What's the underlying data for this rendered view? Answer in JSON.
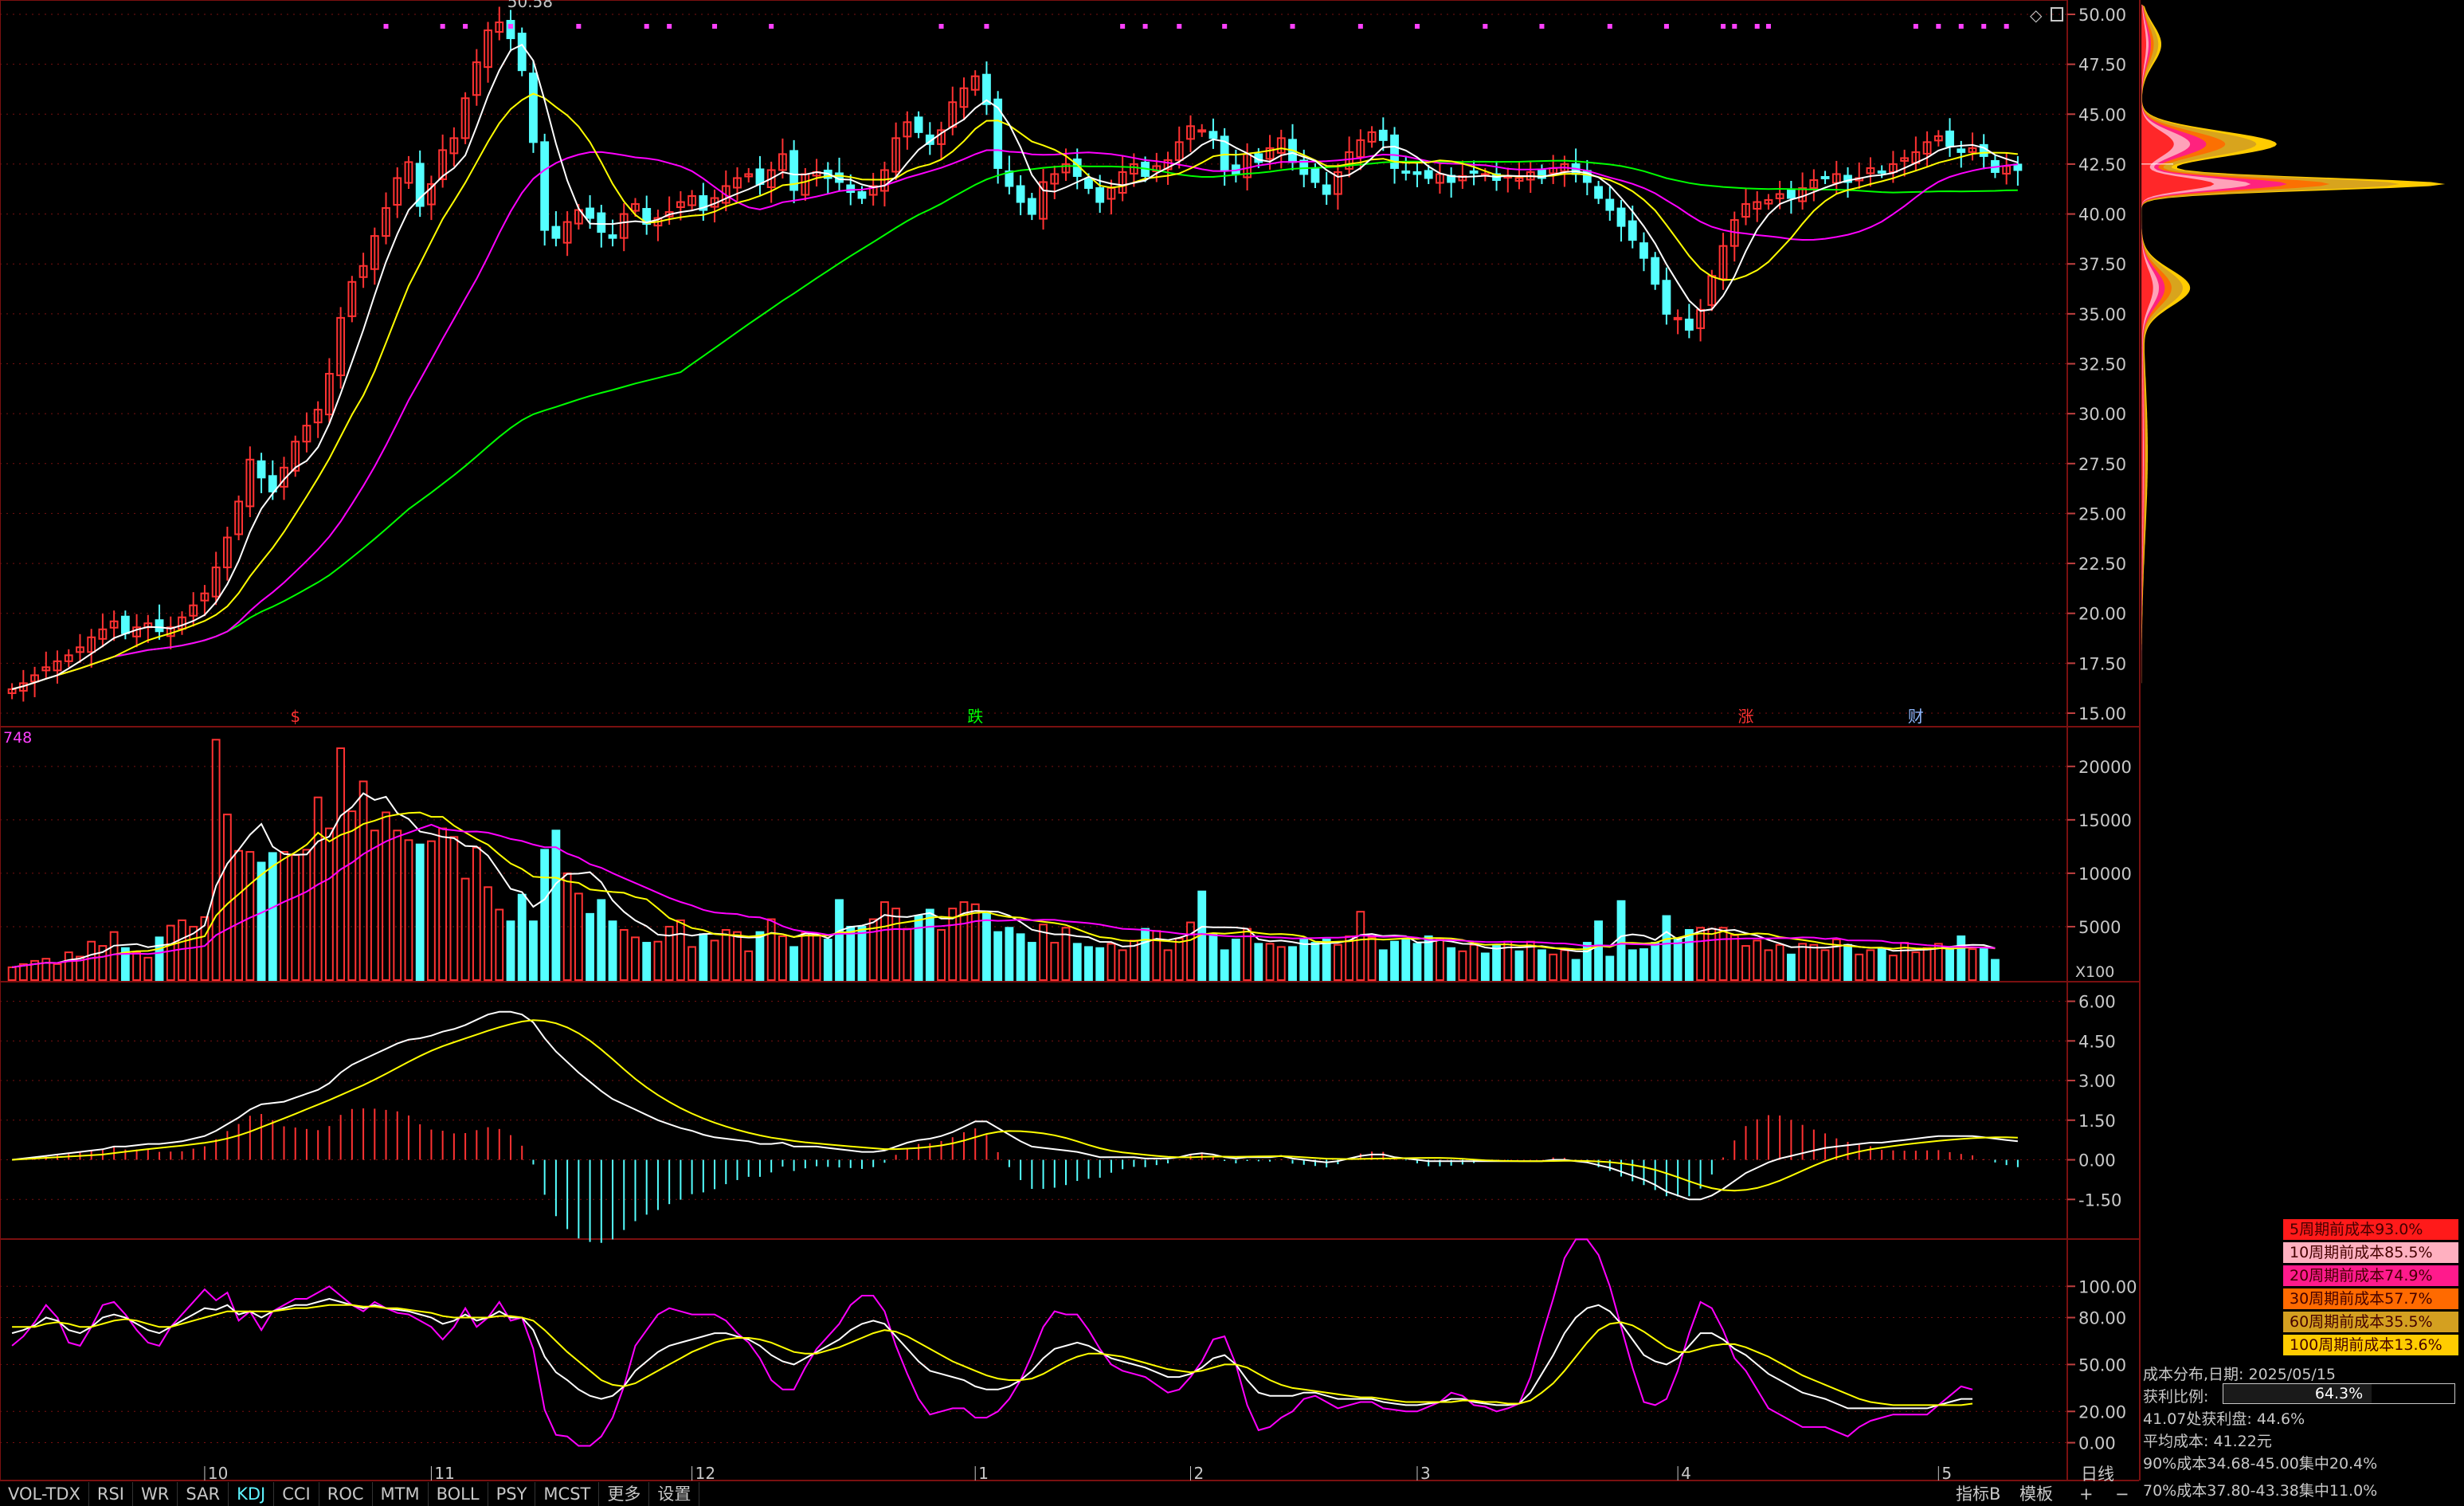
{
  "toolbar": {
    "tabs": [
      "VOL-TDX",
      "RSI",
      "WR",
      "SAR",
      "KDJ",
      "CCI",
      "ROC",
      "MTM",
      "BOLL",
      "PSY",
      "MCST",
      "更多",
      "设置"
    ],
    "active_tab": "KDJ",
    "right_buttons": [
      "指标B",
      "模板",
      "+",
      "−"
    ],
    "period": "日线"
  },
  "main_panel": {
    "price_ticks": [
      "50.00",
      "47.50",
      "45.00",
      "42.50",
      "40.00",
      "37.50",
      "35.00",
      "32.50",
      "30.00",
      "27.50",
      "25.00",
      "22.50",
      "20.00",
      "17.50",
      "15.00"
    ],
    "price_range": [
      15,
      50
    ],
    "high_label": "50.58",
    "markers": [
      {
        "text": "$",
        "idx": 25,
        "color": "#ff3232"
      },
      {
        "text": "跌",
        "idx": 85,
        "color": "#00ff00"
      },
      {
        "text": "涨",
        "idx": 153,
        "color": "#ff3232"
      },
      {
        "text": "财",
        "idx": 168,
        "color": "#8fb8ff"
      }
    ],
    "magenta_dot_indices": [
      33,
      38,
      40,
      44,
      50,
      56,
      58,
      62,
      67,
      82,
      86,
      98,
      100,
      103,
      107,
      113,
      119,
      124,
      130,
      135,
      141,
      146,
      151,
      152,
      154,
      155,
      168,
      170,
      172,
      174,
      176
    ]
  },
  "volume_panel": {
    "label": "748",
    "ticks": [
      "20000",
      "15000",
      "10000",
      "5000"
    ],
    "range": [
      0,
      22000
    ],
    "unit": "X100"
  },
  "macd_panel": {
    "ticks": [
      "6.00",
      "4.50",
      "3.00",
      "1.50",
      "0.00",
      "-1.50"
    ],
    "range": [
      -3.0,
      6.5
    ]
  },
  "kdj_panel": {
    "ticks": [
      "100.00",
      "80.00",
      "50.00",
      "20.00",
      "0.00"
    ],
    "range": [
      -15,
      120
    ]
  },
  "x_axis": {
    "months": [
      {
        "text": "10",
        "idx": 17
      },
      {
        "text": "11",
        "idx": 37
      },
      {
        "text": "12",
        "idx": 60
      },
      {
        "text": "1",
        "idx": 85
      },
      {
        "text": "2",
        "idx": 104
      },
      {
        "text": "3",
        "idx": 124
      },
      {
        "text": "4",
        "idx": 147
      },
      {
        "text": "5",
        "idx": 170
      }
    ]
  },
  "cost_distribution": {
    "legend": [
      {
        "label": "5周期前成本93.0%",
        "color": "#ff1a1a"
      },
      {
        "label": "10周期前成本85.5%",
        "color": "#ffb0c0"
      },
      {
        "label": "20周期前成本74.9%",
        "color": "#ff1a8c"
      },
      {
        "label": "30周期前成本57.7%",
        "color": "#ff6a00"
      },
      {
        "label": "60周期前成本35.5%",
        "color": "#d4a020"
      },
      {
        "label": "100周期前成本13.6%",
        "color": "#ffcc00"
      }
    ],
    "date_line": "成本分布,日期: 2025/05/15",
    "profit_ratio_label": "获利比例:",
    "profit_ratio": "64.3%",
    "profit_ratio_value": 0.643,
    "line_profit_at": "41.07处获利盘: 44.6%",
    "avg_cost": "平均成本: 41.22元",
    "cost_90": "90%成本34.68-45.00集中20.4%",
    "cost_70": "70%成本37.80-43.38集中11.0%"
  },
  "colors": {
    "up": "#ff3232",
    "down": "#54ffff",
    "ma5": "#ffffff",
    "ma10": "#ffff00",
    "ma20": "#ff00ff",
    "ma60": "#00ff00",
    "grid": "#7a1010"
  },
  "series": {
    "close": [
      16.2,
      16.5,
      16.9,
      17.3,
      17.6,
      17.9,
      18.3,
      18.8,
      19.2,
      19.6,
      19.0,
      19.3,
      19.5,
      19.1,
      19.3,
      19.8,
      20.4,
      21.0,
      22.3,
      23.8,
      25.6,
      27.7,
      26.8,
      26.1,
      27.3,
      28.6,
      29.4,
      30.2,
      32.0,
      34.8,
      36.6,
      37.4,
      38.9,
      40.3,
      41.8,
      42.6,
      40.4,
      41.5,
      43.2,
      43.8,
      45.8,
      47.6,
      49.2,
      49.6,
      48.8,
      47.2,
      43.6,
      39.2,
      38.8,
      39.6,
      40.2,
      39.8,
      39.1,
      38.8,
      40.0,
      40.5,
      39.5,
      39.8,
      40.1,
      40.6,
      40.9,
      40.2,
      40.8,
      41.4,
      41.8,
      42.0,
      41.5,
      42.2,
      43.0,
      41.2,
      42.0,
      42.1,
      41.8,
      41.6,
      41.1,
      40.8,
      41.4,
      42.2,
      43.8,
      44.6,
      44.1,
      43.5,
      44.2,
      45.6,
      46.3,
      46.9,
      45.5,
      42.3,
      41.4,
      40.6,
      40.0,
      41.6,
      42.0,
      42.5,
      41.9,
      41.3,
      40.6,
      41.3,
      42.1,
      42.5,
      41.9,
      42.4,
      42.7,
      43.6,
      44.4,
      44.2,
      43.8,
      42.2,
      42.0,
      43.0,
      42.6,
      43.3,
      43.8,
      42.6,
      42.0,
      41.6,
      41.0,
      42.1,
      43.1,
      43.7,
      44.1,
      43.7,
      42.3,
      42.1,
      42.0,
      41.8,
      42.0,
      41.6,
      41.9,
      42.1,
      42.0,
      41.7,
      41.9,
      41.8,
      42.1,
      41.8,
      42.3,
      42.5,
      42.0,
      41.6,
      40.8,
      40.2,
      39.4,
      38.7,
      37.8,
      36.5,
      35.0,
      34.8,
      34.2,
      35.2,
      36.9,
      38.4,
      39.7,
      40.5,
      40.6,
      40.7,
      41.0,
      40.8,
      41.3,
      41.7,
      41.8,
      42.0,
      41.6,
      41.8,
      42.3,
      42.1,
      42.5,
      42.8,
      43.1,
      43.6,
      43.9,
      43.4,
      43.1,
      43.3,
      42.9,
      42.1,
      42.4,
      42.2
    ],
    "volume": [
      1200,
      1500,
      1800,
      2000,
      1500,
      2600,
      2200,
      3600,
      3200,
      4500,
      3000,
      2600,
      2100,
      4000,
      5100,
      5600,
      5000,
      5900,
      22500,
      15500,
      12100,
      12000,
      11000,
      11900,
      12000,
      11700,
      12200,
      17100,
      14200,
      21700,
      15800,
      18600,
      14000,
      15700,
      14000,
      13100,
      12700,
      13000,
      14200,
      13400,
      9500,
      12400,
      8700,
      6600,
      5500,
      8000,
      5500,
      12200,
      14000,
      10000,
      8100,
      6200,
      7500,
      5500,
      4700,
      4000,
      3500,
      3600,
      5000,
      5600,
      3100,
      4300,
      3700,
      4700,
      4500,
      2700,
      4500,
      5700,
      4100,
      3100,
      4400,
      4200,
      3800,
      7500,
      5000,
      5000,
      5700,
      7300,
      6700,
      4800,
      6000,
      6600,
      4700,
      6700,
      7300,
      7100,
      6400,
      4500,
      4900,
      4300,
      3500,
      5200,
      3500,
      4900,
      3400,
      3100,
      3000,
      3400,
      2800,
      3700,
      4800,
      4600,
      2800,
      3900,
      5400,
      8300,
      4300,
      2800,
      3800,
      4800,
      3400,
      3400,
      3100,
      3100,
      3800,
      3500,
      3800,
      3300,
      4100,
      6400,
      4000,
      2800,
      3600,
      3800,
      3400,
      4100,
      3800,
      3000,
      2700,
      3300,
      2500,
      3200,
      3600,
      2700,
      3600,
      2800,
      2400,
      2800,
      1900,
      3500,
      5500,
      2200,
      7400,
      2800,
      2900,
      3500,
      6000,
      3800,
      4700,
      4900,
      4800,
      4900,
      4200,
      3200,
      3700,
      2800,
      3300,
      2400,
      3400,
      3300,
      2800,
      3800,
      3300,
      2400,
      2800,
      2900,
      2300,
      3500,
      2600,
      3000,
      3400,
      3100,
      4100,
      2900,
      2900,
      1900
    ],
    "dif": [
      0.0,
      0.05,
      0.1,
      0.15,
      0.2,
      0.25,
      0.3,
      0.35,
      0.4,
      0.5,
      0.5,
      0.55,
      0.6,
      0.6,
      0.65,
      0.7,
      0.8,
      0.9,
      1.1,
      1.35,
      1.6,
      1.9,
      2.1,
      2.15,
      2.2,
      2.35,
      2.5,
      2.65,
      2.9,
      3.3,
      3.6,
      3.8,
      4.0,
      4.2,
      4.4,
      4.55,
      4.6,
      4.7,
      4.85,
      4.95,
      5.1,
      5.3,
      5.5,
      5.6,
      5.6,
      5.5,
      5.2,
      4.6,
      4.1,
      3.7,
      3.3,
      2.95,
      2.6,
      2.3,
      2.1,
      1.9,
      1.7,
      1.5,
      1.35,
      1.2,
      1.1,
      0.95,
      0.85,
      0.8,
      0.75,
      0.7,
      0.6,
      0.6,
      0.65,
      0.5,
      0.5,
      0.5,
      0.45,
      0.4,
      0.35,
      0.3,
      0.3,
      0.35,
      0.5,
      0.65,
      0.75,
      0.8,
      0.9,
      1.05,
      1.25,
      1.45,
      1.45,
      1.2,
      0.95,
      0.7,
      0.5,
      0.45,
      0.4,
      0.35,
      0.3,
      0.2,
      0.1,
      0.1,
      0.1,
      0.1,
      0.05,
      0.05,
      0.05,
      0.1,
      0.2,
      0.25,
      0.2,
      0.1,
      0.05,
      0.1,
      0.1,
      0.1,
      0.15,
      0.05,
      0.0,
      -0.05,
      -0.1,
      -0.05,
      0.05,
      0.15,
      0.2,
      0.2,
      0.1,
      0.05,
      0.0,
      -0.05,
      -0.05,
      -0.05,
      -0.05,
      -0.05,
      -0.05,
      -0.05,
      -0.05,
      -0.05,
      -0.05,
      -0.05,
      0.0,
      0.0,
      -0.05,
      -0.1,
      -0.2,
      -0.3,
      -0.45,
      -0.6,
      -0.75,
      -0.95,
      -1.2,
      -1.35,
      -1.5,
      -1.5,
      -1.35,
      -1.1,
      -0.8,
      -0.5,
      -0.3,
      -0.1,
      0.05,
      0.15,
      0.25,
      0.35,
      0.45,
      0.5,
      0.55,
      0.6,
      0.65,
      0.65,
      0.7,
      0.75,
      0.8,
      0.85,
      0.9,
      0.9,
      0.9,
      0.9,
      0.85,
      0.8,
      0.75,
      0.7
    ],
    "kdj_k": [
      70,
      72,
      75,
      80,
      78,
      72,
      70,
      74,
      80,
      82,
      80,
      76,
      72,
      70,
      74,
      78,
      82,
      86,
      85,
      88,
      82,
      84,
      80,
      84,
      86,
      88,
      88,
      90,
      92,
      90,
      88,
      86,
      88,
      86,
      85,
      84,
      82,
      80,
      76,
      78,
      82,
      78,
      80,
      84,
      80,
      80,
      72,
      55,
      45,
      40,
      34,
      30,
      28,
      30,
      36,
      46,
      52,
      58,
      62,
      64,
      66,
      68,
      70,
      70,
      68,
      66,
      62,
      56,
      52,
      50,
      54,
      58,
      62,
      66,
      72,
      76,
      78,
      76,
      68,
      60,
      52,
      46,
      44,
      42,
      40,
      36,
      34,
      34,
      36,
      40,
      46,
      54,
      60,
      62,
      64,
      62,
      58,
      54,
      52,
      50,
      48,
      45,
      42,
      42,
      44,
      48,
      54,
      56,
      50,
      40,
      32,
      30,
      30,
      30,
      32,
      32,
      30,
      28,
      28,
      28,
      28,
      26,
      25,
      24,
      24,
      25,
      26,
      28,
      28,
      26,
      25,
      24,
      24,
      25,
      32,
      44,
      56,
      70,
      80,
      86,
      88,
      84,
      76,
      66,
      56,
      52,
      50,
      54,
      62,
      70,
      70,
      66,
      60,
      56,
      50,
      44,
      40,
      36,
      32,
      30,
      28,
      25,
      22,
      22,
      22,
      22,
      22,
      22,
      22,
      22,
      24,
      26,
      28,
      28
    ],
    "kdj_d": [
      74,
      74,
      74,
      76,
      77,
      76,
      74,
      74,
      76,
      78,
      79,
      78,
      76,
      74,
      74,
      76,
      78,
      80,
      82,
      84,
      84,
      84,
      84,
      84,
      85,
      86,
      86,
      87,
      88,
      88,
      88,
      87,
      87,
      86,
      86,
      85,
      84,
      83,
      81,
      80,
      80,
      80,
      80,
      81,
      81,
      80,
      78,
      72,
      65,
      58,
      52,
      46,
      40,
      37,
      36,
      38,
      42,
      46,
      50,
      54,
      58,
      61,
      64,
      66,
      67,
      67,
      66,
      64,
      61,
      58,
      57,
      57,
      59,
      61,
      64,
      67,
      70,
      72,
      71,
      68,
      64,
      60,
      56,
      52,
      49,
      46,
      43,
      41,
      40,
      40,
      41,
      44,
      48,
      52,
      55,
      57,
      57,
      56,
      55,
      53,
      51,
      49,
      47,
      46,
      45,
      46,
      48,
      50,
      50,
      48,
      44,
      40,
      37,
      35,
      34,
      33,
      32,
      31,
      30,
      29,
      29,
      28,
      27,
      26,
      26,
      26,
      26,
      26,
      27,
      27,
      26,
      26,
      25,
      25,
      27,
      32,
      38,
      46,
      55,
      64,
      72,
      76,
      77,
      75,
      71,
      66,
      61,
      58,
      58,
      60,
      62,
      63,
      63,
      61,
      58,
      55,
      51,
      47,
      43,
      40,
      37,
      34,
      31,
      28,
      26,
      25,
      24,
      24,
      24,
      24,
      24,
      24,
      24,
      25
    ],
    "kdj_j": [
      62,
      68,
      77,
      88,
      80,
      64,
      62,
      74,
      88,
      90,
      82,
      72,
      64,
      62,
      74,
      82,
      90,
      98,
      91,
      96,
      78,
      84,
      72,
      84,
      88,
      92,
      92,
      96,
      100,
      94,
      88,
      84,
      90,
      86,
      83,
      82,
      78,
      74,
      66,
      74,
      86,
      74,
      80,
      90,
      78,
      80,
      60,
      21,
      5,
      4,
      -2,
      -2,
      4,
      16,
      36,
      62,
      72,
      82,
      86,
      84,
      82,
      82,
      82,
      78,
      70,
      64,
      54,
      40,
      34,
      34,
      48,
      60,
      68,
      76,
      88,
      94,
      94,
      84,
      62,
      44,
      28,
      18,
      20,
      22,
      22,
      16,
      16,
      20,
      28,
      40,
      56,
      74,
      84,
      82,
      82,
      72,
      60,
      50,
      46,
      44,
      42,
      37,
      32,
      34,
      42,
      52,
      66,
      68,
      50,
      24,
      8,
      10,
      16,
      20,
      28,
      30,
      26,
      22,
      24,
      26,
      26,
      22,
      21,
      20,
      20,
      23,
      26,
      32,
      30,
      24,
      23,
      20,
      22,
      25,
      42,
      68,
      92,
      118,
      130,
      130,
      120,
      100,
      74,
      48,
      26,
      24,
      28,
      46,
      70,
      90,
      86,
      72,
      54,
      46,
      34,
      22,
      18,
      14,
      10,
      10,
      10,
      7,
      4,
      10,
      14,
      16,
      18,
      18,
      18,
      18,
      24,
      30,
      36,
      34
    ]
  }
}
